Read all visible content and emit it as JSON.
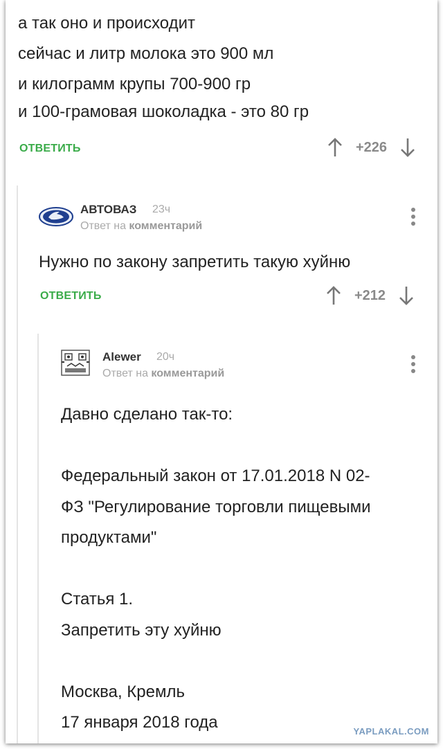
{
  "comment_top": {
    "lines": [
      "а так оно и происходит",
      "сейчас и литр молока это 900 мл",
      "и килограмм крупы 700-900 гр",
      "и 100-грамовая шоколадка - это 80 гр"
    ],
    "reply_label": "ОТВЕТИТЬ",
    "score": "+226"
  },
  "comment_2": {
    "author": "АВТОВАЗ",
    "time": "23ч",
    "reply_prefix": "Ответ на",
    "reply_target": "комментарий",
    "text": "Нужно по закону запретить такую хуйню",
    "reply_label": "ОТВЕТИТЬ",
    "score": "+212"
  },
  "comment_3": {
    "author": "Alewer",
    "time": "20ч",
    "reply_prefix": "Ответ на",
    "reply_target": "комментарий",
    "lines": [
      "Давно сделано так-то:",
      "",
      "Федеральный закон от 17.01.2018 N 02-",
      "ФЗ \"Регулирование торговли пищевыми",
      "продуктами\"",
      "",
      "Статья 1.",
      "Запретить эту хуйню",
      "",
      "Москва, Кремль",
      "17 января 2018 года"
    ]
  },
  "watermark": "YAPLAKAL.COM",
  "colors": {
    "accent_green": "#3aab49",
    "muted": "#aaaaaa",
    "lada_blue": "#1f3f8f"
  },
  "icons": [
    "up-arrow-icon",
    "down-arrow-icon",
    "kebab-menu-icon",
    "lada-logo-icon",
    "robot-avatar-icon"
  ]
}
